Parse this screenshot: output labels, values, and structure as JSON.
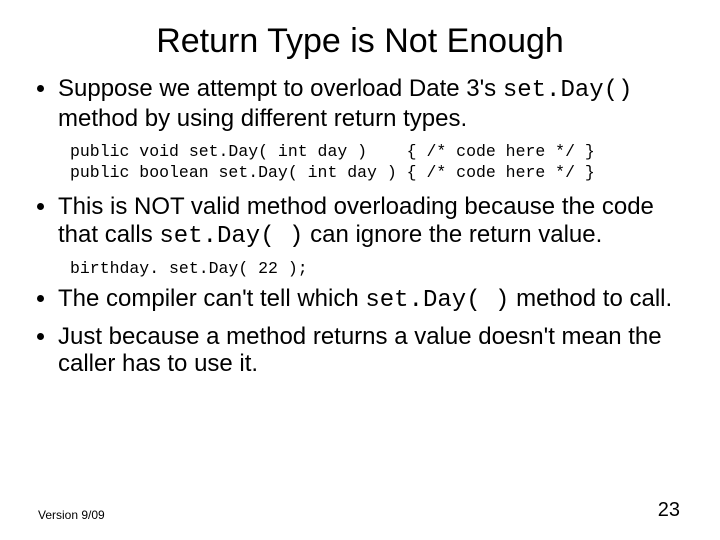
{
  "title": "Return Type is Not Enough",
  "bullets": {
    "b1_pre": "Suppose we attempt to overload Date 3's ",
    "b1_code": "set.Day()",
    "b1_post": " method by using different return types.",
    "code1_line1": "public void set.Day( int day )    { /* code here */ }",
    "code1_line2": "public boolean set.Day( int day ) { /* code here */ }",
    "b2_pre": "This is NOT valid method overloading because the code that calls ",
    "b2_code": "set.Day( )",
    "b2_post": " can ignore the return value.",
    "code2": "birthday. set.Day( 22 );",
    "b3_pre": "The compiler can't tell which ",
    "b3_code": "set.Day( )",
    "b3_post": " method to call.",
    "b4": "Just because a method returns a value doesn't mean the caller has to use it."
  },
  "footer": {
    "version": "Version 9/09",
    "page": "23"
  }
}
